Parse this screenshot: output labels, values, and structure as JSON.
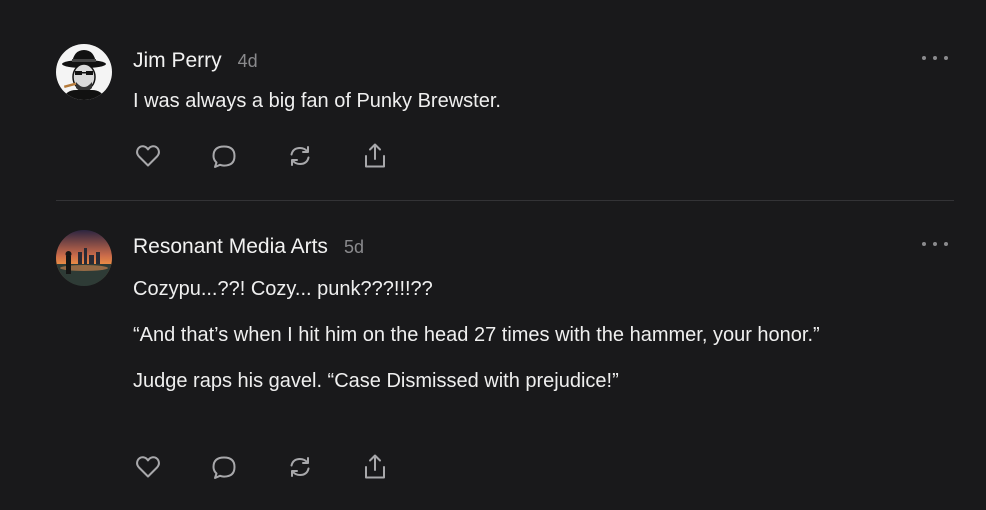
{
  "comments": [
    {
      "author": "Jim Perry",
      "time": "4d",
      "paragraphs": [
        "I was always a big fan of Punky Brewster."
      ],
      "avatar_icon": "fedora-man-avatar"
    },
    {
      "author": "Resonant Media Arts",
      "time": "5d",
      "paragraphs": [
        "Cozypu...??! Cozy... punk???!!!??",
        "“And that’s when I hit him on the head 27 times with the hammer, your honor.”",
        "Judge raps his gavel. “Case Dismissed with prejudice!”"
      ],
      "avatar_icon": "sunset-city-avatar"
    }
  ],
  "action_icons": [
    "heart-icon",
    "comment-icon",
    "restack-icon",
    "share-icon"
  ],
  "colors": {
    "background": "#19191b",
    "text": "#efefef",
    "muted": "#8a8a8d",
    "divider": "#333336"
  }
}
